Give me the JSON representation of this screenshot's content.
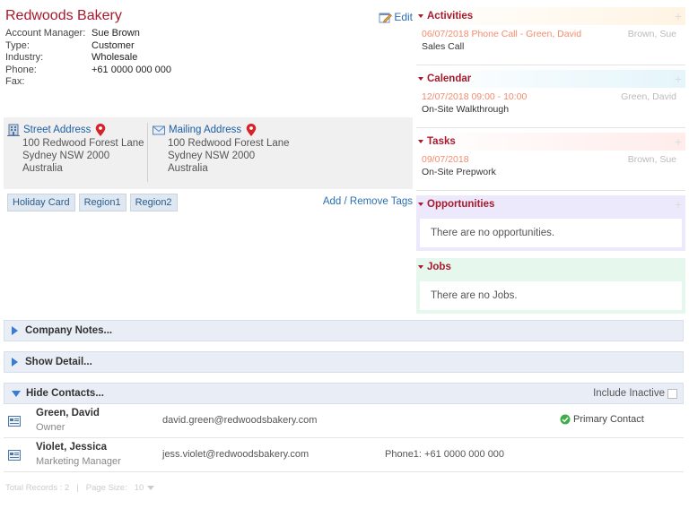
{
  "company": {
    "name": "Redwoods Bakery",
    "edit_label": "Edit",
    "fields": [
      {
        "label": "Account Manager:",
        "value": "Sue Brown"
      },
      {
        "label": "Type:",
        "value": "Customer"
      },
      {
        "label": "Industry:",
        "value": "Wholesale"
      },
      {
        "label": "Phone:",
        "value": "+61 0000 000 000"
      },
      {
        "label": "Fax:",
        "value": ""
      }
    ],
    "street_address": {
      "title": "Street Address",
      "lines": [
        "100 Redwood Forest Lane",
        "Sydney NSW 2000",
        "Australia"
      ]
    },
    "mailing_address": {
      "title": "Mailing Address",
      "lines": [
        "100 Redwood Forest Lane",
        "Sydney NSW 2000",
        "Australia"
      ]
    },
    "tags": [
      "Holiday Card",
      "Region1",
      "Region2"
    ],
    "tags_link": "Add / Remove Tags"
  },
  "panels": {
    "activities": {
      "title": "Activities",
      "when": "06/07/2018 Phone Call - Green, David",
      "who": "Brown, Sue",
      "subject": "Sales Call"
    },
    "calendar": {
      "title": "Calendar",
      "when": "12/07/2018 09:00 - 10:00",
      "who": "Green, David",
      "subject": "On-Site Walkthrough"
    },
    "tasks": {
      "title": "Tasks",
      "when": "09/07/2018",
      "who": "Brown, Sue",
      "subject": "On-Site Prepwork"
    },
    "opportunities": {
      "title": "Opportunities",
      "empty": "There are no opportunities."
    },
    "jobs": {
      "title": "Jobs",
      "empty": "There are no Jobs."
    }
  },
  "sections": {
    "company_notes": "Company Notes...",
    "show_detail": "Show Detail...",
    "hide_contacts": "Hide Contacts...",
    "include_inactive": "Include Inactive"
  },
  "contacts": [
    {
      "name": "Green, David",
      "role": "Owner",
      "email": "david.green@redwoodsbakery.com",
      "phone": "",
      "primary": "Primary Contact"
    },
    {
      "name": "Violet, Jessica",
      "role": "Marketing Manager",
      "email": "jess.violet@redwoodsbakery.com",
      "phone": "Phone1: +61 0000 000 000",
      "primary": ""
    }
  ],
  "footer": {
    "total": "Total Records : 2",
    "separator": "|",
    "page_size_label": "Page Size:",
    "page_size_value": "10"
  },
  "colors": {
    "accent": "#a8192c",
    "link": "#2a6fb0",
    "activity_date": "#f48b6e"
  },
  "icons": {
    "edit": "edit-pencil-icon",
    "street": "building-icon",
    "mail": "envelope-icon",
    "pin": "map-pin-icon",
    "contact": "vcard-icon",
    "primary": "check-circle-icon",
    "add": "plus-icon"
  }
}
